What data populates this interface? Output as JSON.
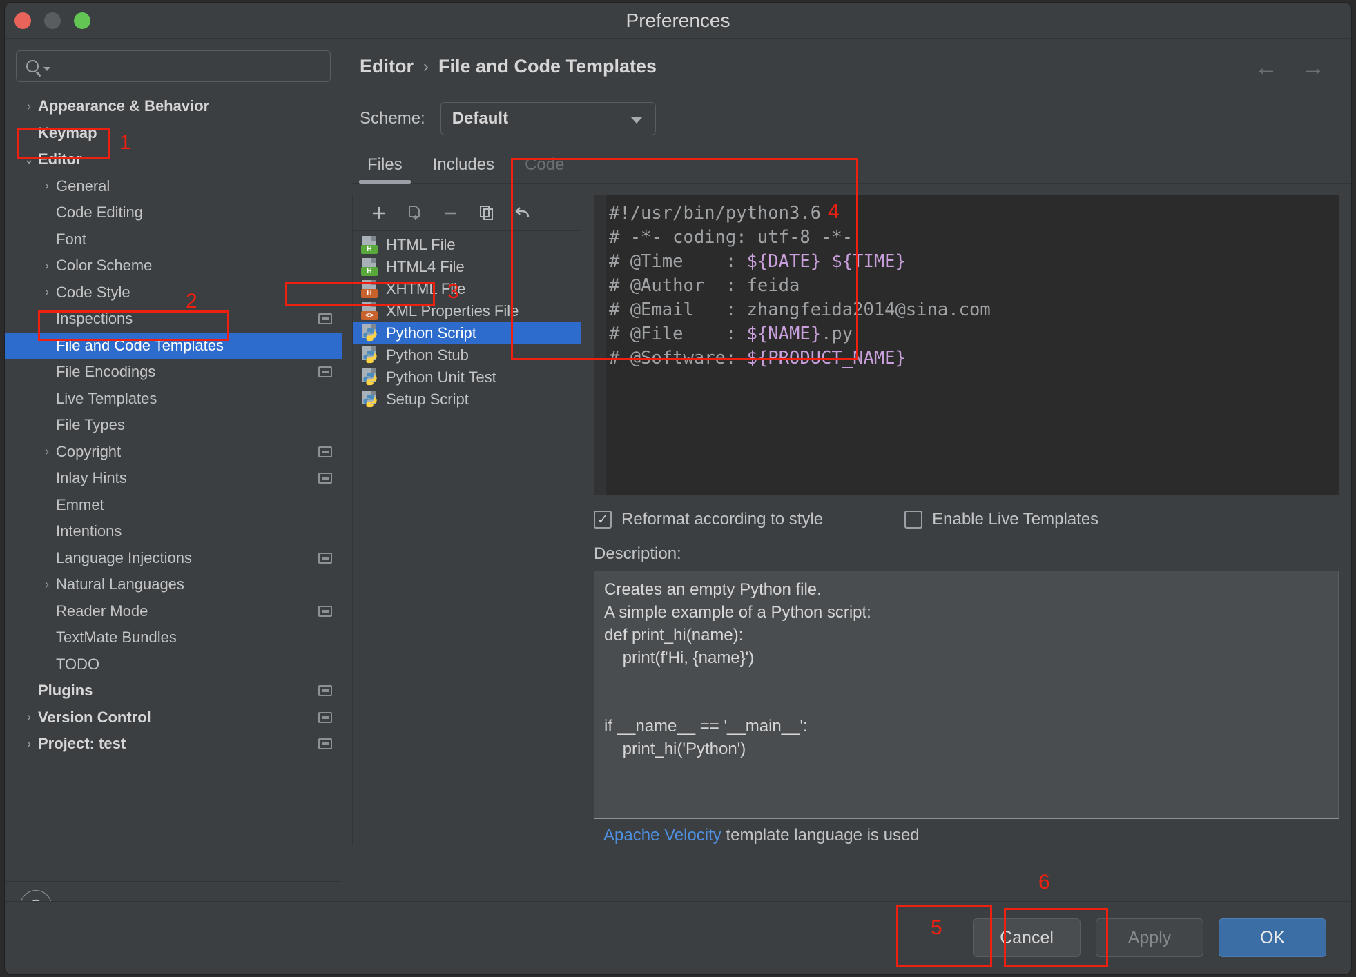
{
  "window": {
    "title": "Preferences",
    "traffic_lights": [
      "close",
      "minimize",
      "zoom"
    ]
  },
  "sidebar": {
    "search_placeholder": "",
    "items": [
      {
        "label": "Appearance & Behavior",
        "level": 0,
        "arrow": "›",
        "bold": true
      },
      {
        "label": "Keymap",
        "level": 0,
        "arrow": "",
        "bold": true
      },
      {
        "label": "Editor",
        "level": 0,
        "arrow": "⌄",
        "bold": true
      },
      {
        "label": "General",
        "level": 1,
        "arrow": "›",
        "bold": false
      },
      {
        "label": "Code Editing",
        "level": 1,
        "arrow": "",
        "bold": false
      },
      {
        "label": "Font",
        "level": 1,
        "arrow": "",
        "bold": false
      },
      {
        "label": "Color Scheme",
        "level": 1,
        "arrow": "›",
        "bold": false
      },
      {
        "label": "Code Style",
        "level": 1,
        "arrow": "›",
        "bold": false
      },
      {
        "label": "Inspections",
        "level": 1,
        "arrow": "",
        "bold": false,
        "badge": true
      },
      {
        "label": "File and Code Templates",
        "level": 1,
        "arrow": "",
        "bold": false,
        "selected": true
      },
      {
        "label": "File Encodings",
        "level": 1,
        "arrow": "",
        "bold": false,
        "badge": true
      },
      {
        "label": "Live Templates",
        "level": 1,
        "arrow": "",
        "bold": false
      },
      {
        "label": "File Types",
        "level": 1,
        "arrow": "",
        "bold": false
      },
      {
        "label": "Copyright",
        "level": 1,
        "arrow": "›",
        "bold": false,
        "badge": true
      },
      {
        "label": "Inlay Hints",
        "level": 1,
        "arrow": "",
        "bold": false,
        "badge": true
      },
      {
        "label": "Emmet",
        "level": 1,
        "arrow": "",
        "bold": false
      },
      {
        "label": "Intentions",
        "level": 1,
        "arrow": "",
        "bold": false
      },
      {
        "label": "Language Injections",
        "level": 1,
        "arrow": "",
        "bold": false,
        "badge": true
      },
      {
        "label": "Natural Languages",
        "level": 1,
        "arrow": "›",
        "bold": false
      },
      {
        "label": "Reader Mode",
        "level": 1,
        "arrow": "",
        "bold": false,
        "badge": true
      },
      {
        "label": "TextMate Bundles",
        "level": 1,
        "arrow": "",
        "bold": false
      },
      {
        "label": "TODO",
        "level": 1,
        "arrow": "",
        "bold": false
      },
      {
        "label": "Plugins",
        "level": 0,
        "arrow": "",
        "bold": true,
        "badge": true
      },
      {
        "label": "Version Control",
        "level": 0,
        "arrow": "›",
        "bold": true,
        "badge": true
      },
      {
        "label": "Project: test",
        "level": 0,
        "arrow": "›",
        "bold": true,
        "badge": true
      }
    ],
    "help_label": "?"
  },
  "main": {
    "breadcrumb": {
      "parent": "Editor",
      "separator": "›",
      "current": "File and Code Templates"
    },
    "nav": {
      "back": "←",
      "forward": "→"
    },
    "scheme": {
      "label": "Scheme:",
      "value": "Default"
    },
    "tabs": [
      {
        "label": "Files",
        "state": "active"
      },
      {
        "label": "Includes",
        "state": "normal"
      },
      {
        "label": "Code",
        "state": "disabled"
      }
    ],
    "toolbar": {
      "add": "+",
      "copy_template": "copy-template",
      "remove": "−",
      "duplicate": "duplicate",
      "reset": "↺"
    },
    "file_items": [
      {
        "label": "HTML File",
        "icon": "html-file-icon",
        "tag": "H",
        "tag_color": "green"
      },
      {
        "label": "HTML4 File",
        "icon": "html-file-icon",
        "tag": "H",
        "tag_color": "green"
      },
      {
        "label": "XHTML File",
        "icon": "xhtml-file-icon",
        "tag": "H",
        "tag_color": "orange"
      },
      {
        "label": "XML Properties File",
        "icon": "xml-file-icon",
        "tag": "<>",
        "tag_color": "orange"
      },
      {
        "label": "Python Script",
        "icon": "python-file-icon",
        "selected": true
      },
      {
        "label": "Python Stub",
        "icon": "python-file-icon"
      },
      {
        "label": "Python Unit Test",
        "icon": "python-file-icon"
      },
      {
        "label": "Setup Script",
        "icon": "python-file-icon"
      }
    ],
    "code_lines": [
      [
        {
          "t": "#!/usr/bin/python3.6",
          "c": "plain"
        }
      ],
      [
        {
          "t": "# -*- coding: utf-8 -*-",
          "c": "plain"
        }
      ],
      [
        {
          "t": "# @Time    : ",
          "c": "plain"
        },
        {
          "t": "${DATE} ${TIME}",
          "c": "var"
        }
      ],
      [
        {
          "t": "# @Author  : feida",
          "c": "plain"
        }
      ],
      [
        {
          "t": "# @Email   : zhangfeida2014@sina.com",
          "c": "plain"
        }
      ],
      [
        {
          "t": "# @File    : ",
          "c": "plain"
        },
        {
          "t": "${NAME}",
          "c": "var"
        },
        {
          "t": ".py",
          "c": "plain"
        }
      ],
      [
        {
          "t": "# @Software: ",
          "c": "plain"
        },
        {
          "t": "${PRODUCT_NAME}",
          "c": "var"
        }
      ]
    ],
    "checkboxes": [
      {
        "label": "Reformat according to style",
        "checked": true,
        "mark": "✓"
      },
      {
        "label": "Enable Live Templates",
        "checked": false,
        "mark": ""
      }
    ],
    "description_label": "Description:",
    "description_text": "Creates an empty Python file.\nA simple example of a Python script:\ndef print_hi(name):\n    print(f'Hi, {name}')\n\n\nif __name__ == '__main__':\n    print_hi('Python')",
    "velocity": {
      "link": "Apache Velocity",
      "rest": " template language is used"
    }
  },
  "footer": {
    "cancel": "Cancel",
    "apply": "Apply",
    "ok": "OK"
  },
  "annotations": [
    {
      "num": "1"
    },
    {
      "num": "2"
    },
    {
      "num": "3"
    },
    {
      "num": "4"
    },
    {
      "num": "5"
    },
    {
      "num": "6"
    }
  ],
  "colors": {
    "accent_blue": "#2d6ccc",
    "annotation_red": "#f02010",
    "link_blue": "#4e8fe0",
    "primary_button": "#3b6ea5",
    "template_var": "#c9a0dc"
  }
}
